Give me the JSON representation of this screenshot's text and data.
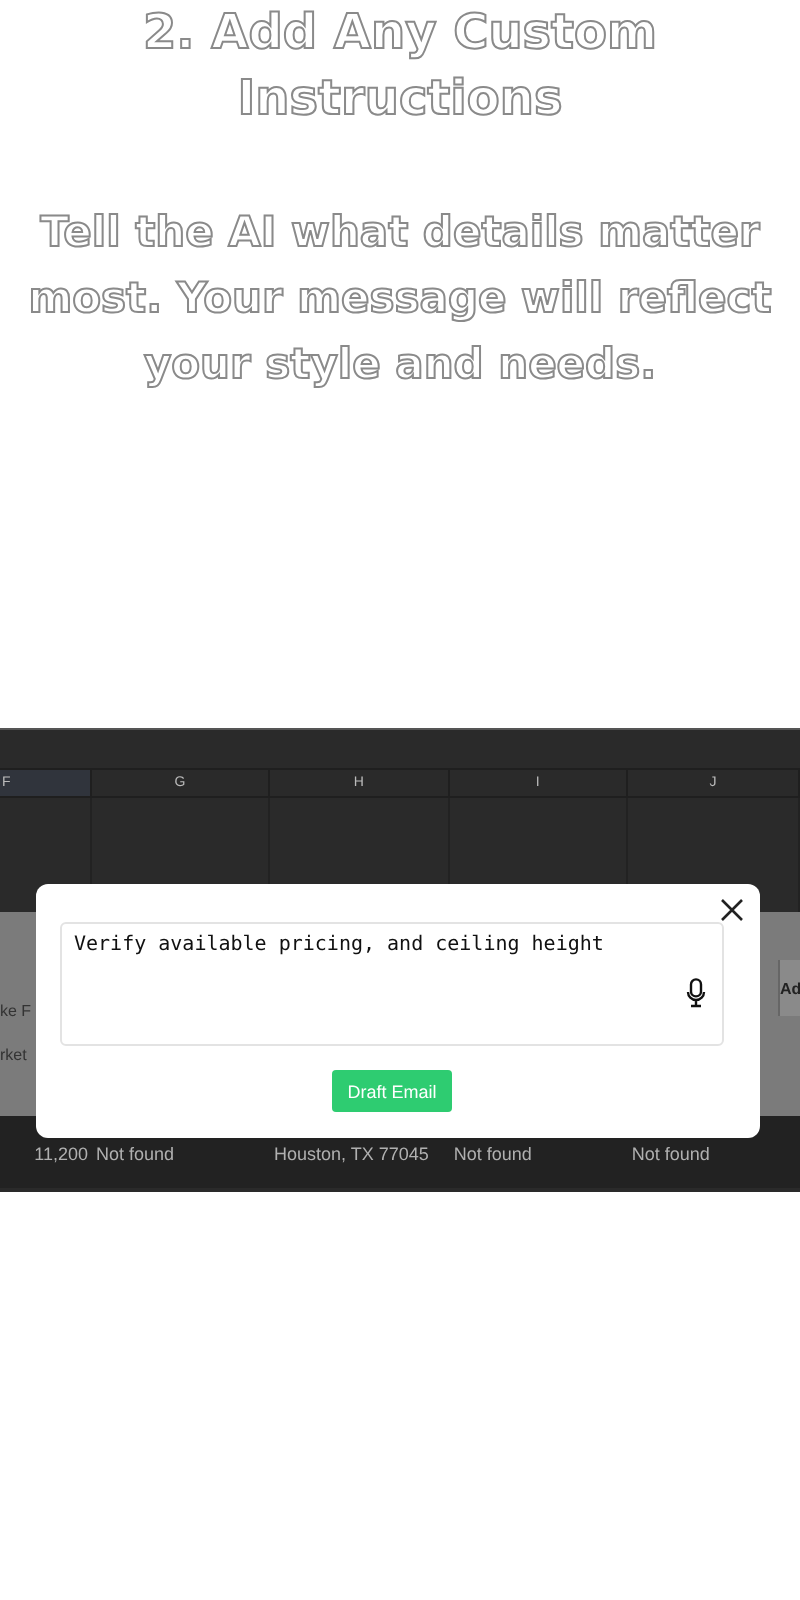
{
  "heading": {
    "title": "2. Add Any Custom Instructions",
    "description": "Tell the AI what details matter most. Your message will reflect your style and needs."
  },
  "spreadsheet": {
    "columns": [
      {
        "label": "F",
        "selected": true
      },
      {
        "label": "G",
        "selected": false
      },
      {
        "label": "H",
        "selected": false
      },
      {
        "label": "I",
        "selected": false
      },
      {
        "label": "J",
        "selected": false
      }
    ],
    "panel_fragments": [
      "ke F",
      "rket"
    ],
    "panel_header": "Ad",
    "row": [
      "11,200",
      "Not found",
      "Houston, TX 77045",
      "Not found",
      "Not found"
    ]
  },
  "modal": {
    "instructions": "Verify available pricing, and ceiling height",
    "button": "Draft Email"
  }
}
